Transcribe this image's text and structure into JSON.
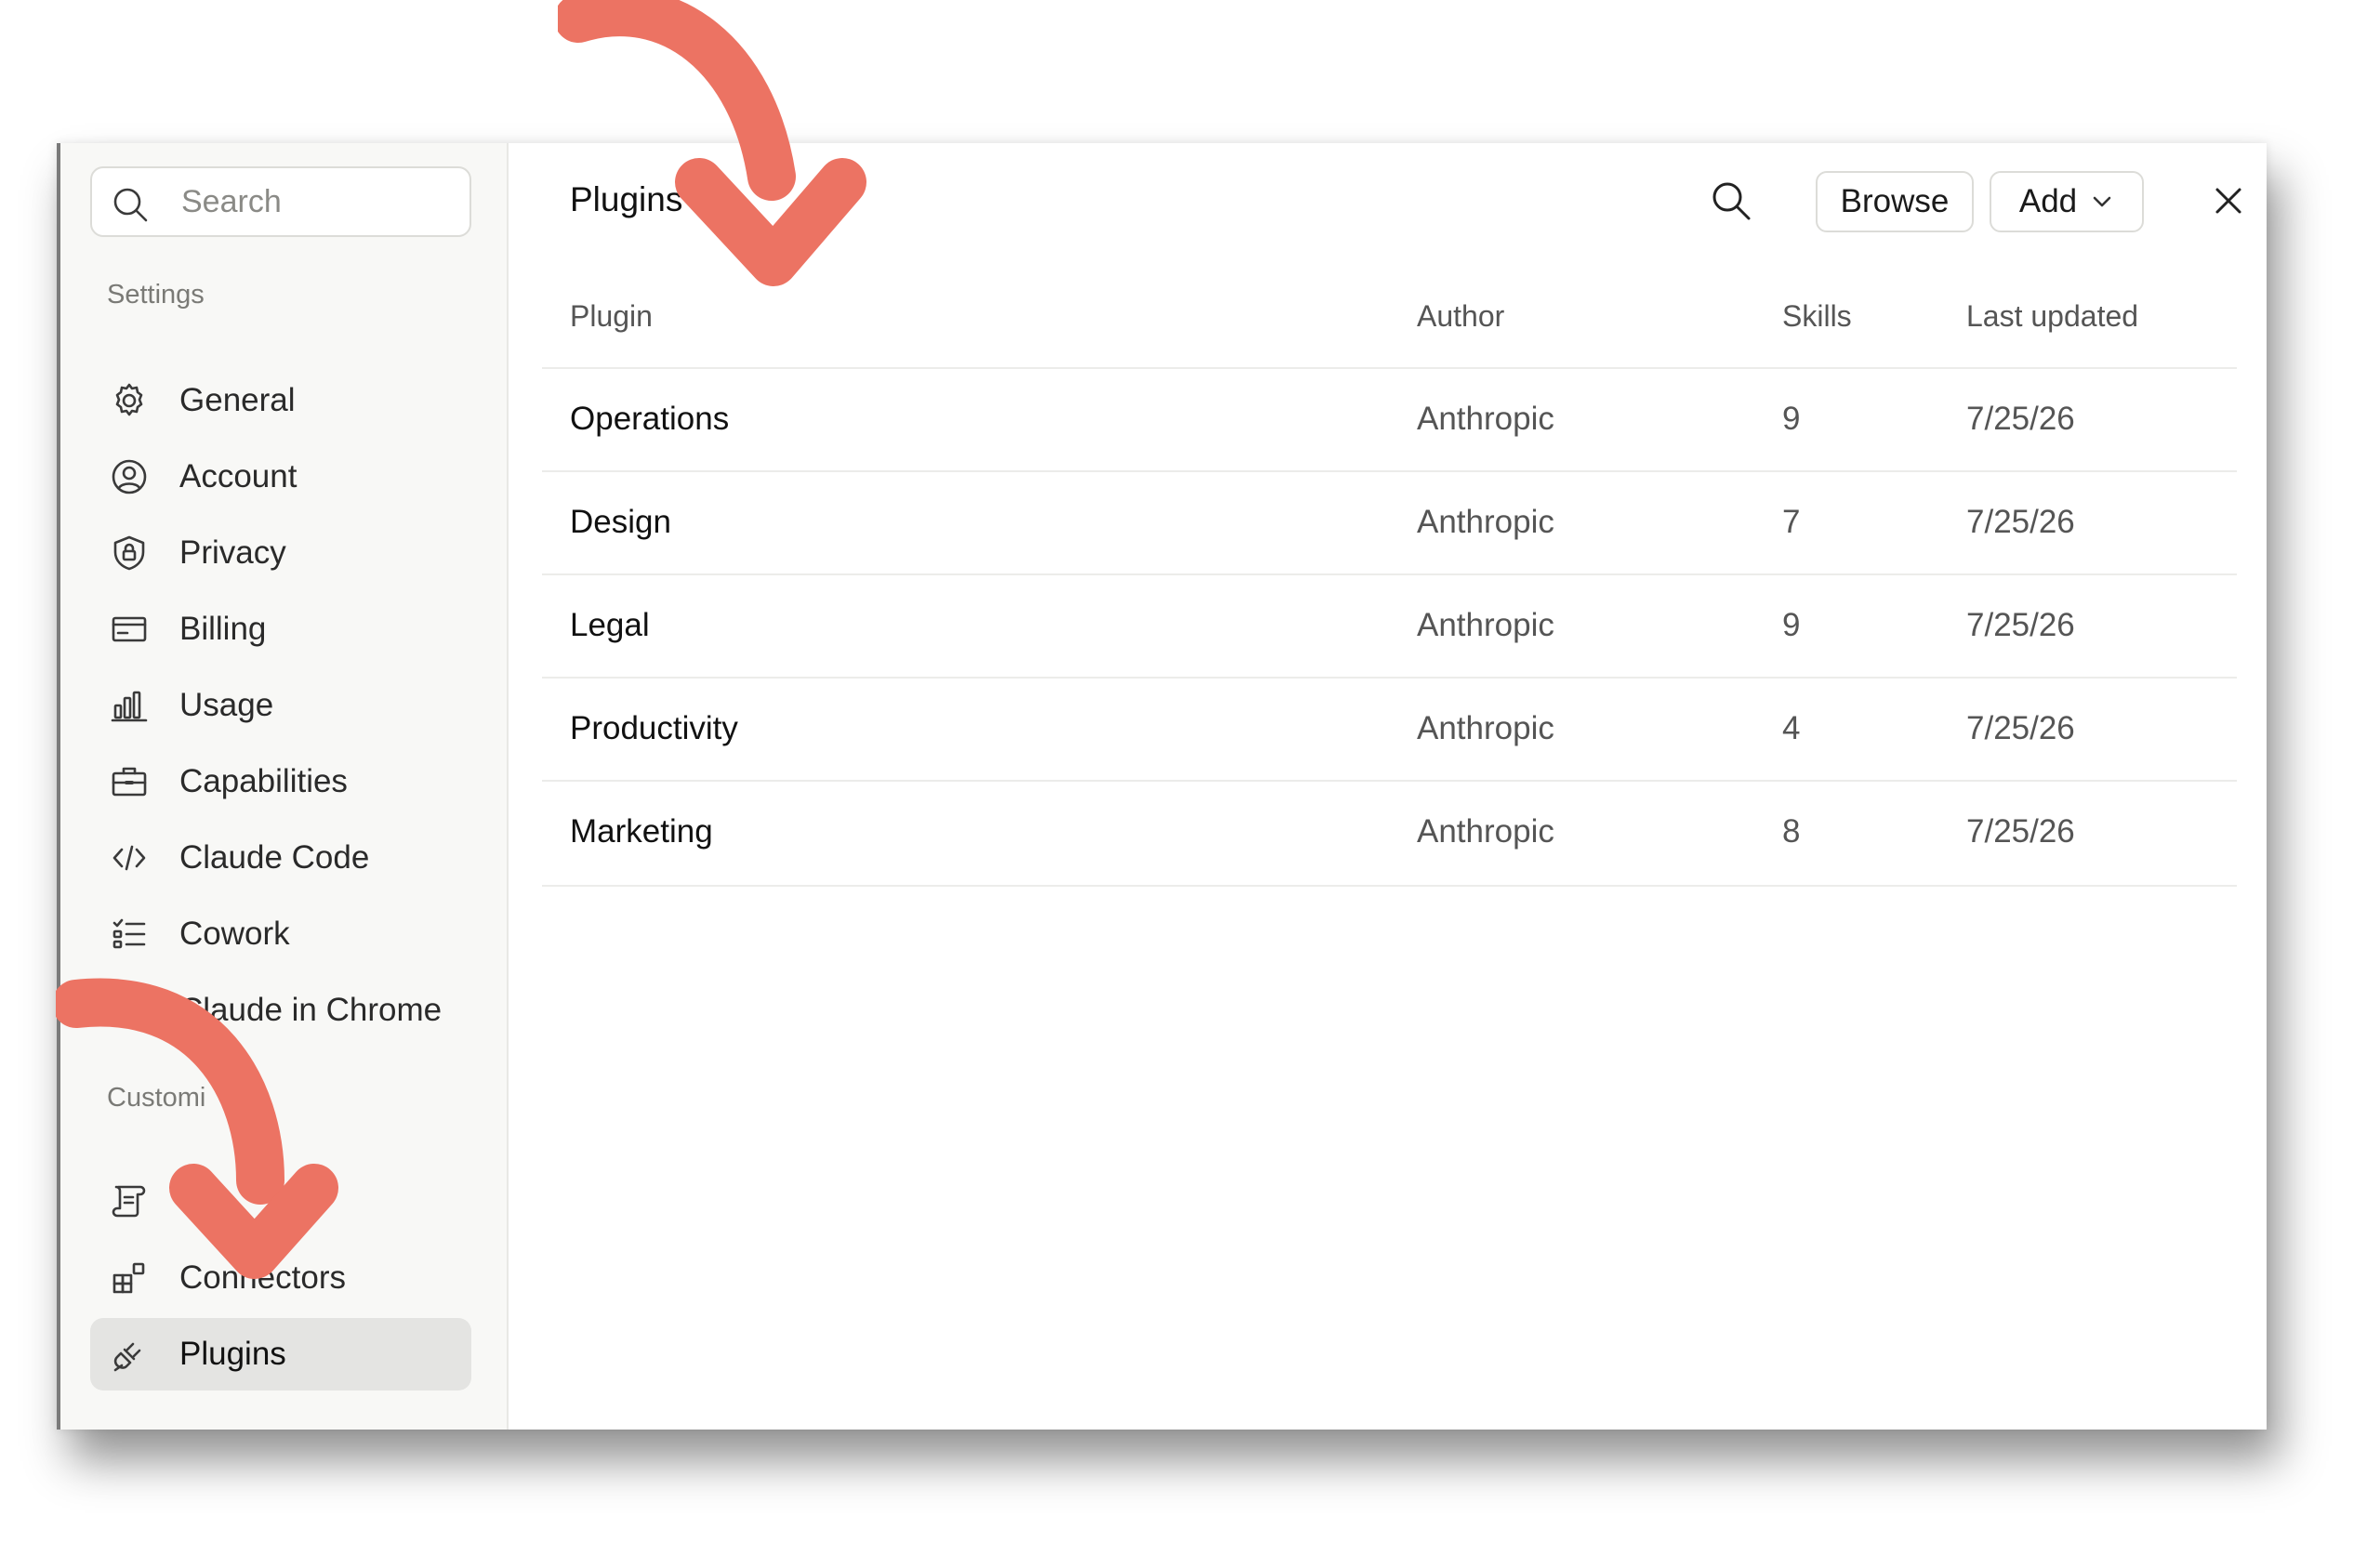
{
  "sidebar": {
    "search_placeholder": "Search",
    "settings_label": "Settings",
    "customize_label": "Customi",
    "items": [
      {
        "label": "General",
        "icon": "gear-icon"
      },
      {
        "label": "Account",
        "icon": "user-circle-icon"
      },
      {
        "label": "Privacy",
        "icon": "shield-lock-icon"
      },
      {
        "label": "Billing",
        "icon": "credit-card-icon"
      },
      {
        "label": "Usage",
        "icon": "bar-chart-icon"
      },
      {
        "label": "Capabilities",
        "icon": "briefcase-icon"
      },
      {
        "label": "Claude Code",
        "icon": "code-icon"
      },
      {
        "label": "Cowork",
        "icon": "checklist-icon"
      },
      {
        "label": "Claude in Chrome",
        "icon": "chrome-icon"
      }
    ],
    "customize_items": [
      {
        "label": "",
        "icon": "scroll-icon"
      },
      {
        "label": "Connectors",
        "icon": "grid-plus-icon"
      },
      {
        "label": "Plugins",
        "icon": "plug-icon",
        "active": true
      }
    ]
  },
  "header": {
    "title": "Plugins",
    "browse_label": "Browse",
    "add_label": "Add"
  },
  "table": {
    "columns": [
      "Plugin",
      "Author",
      "Skills",
      "Last updated"
    ],
    "rows": [
      {
        "plugin": "Operations",
        "author": "Anthropic",
        "skills": "9",
        "updated": "7/25/26"
      },
      {
        "plugin": "Design",
        "author": "Anthropic",
        "skills": "7",
        "updated": "7/25/26"
      },
      {
        "plugin": "Legal",
        "author": "Anthropic",
        "skills": "9",
        "updated": "7/25/26"
      },
      {
        "plugin": "Productivity",
        "author": "Anthropic",
        "skills": "4",
        "updated": "7/25/26"
      },
      {
        "plugin": "Marketing",
        "author": "Anthropic",
        "skills": "8",
        "updated": "7/25/26"
      }
    ]
  },
  "colors": {
    "annotation_arrow": "#ec7363",
    "active_item_bg": "#e4e4e2",
    "sidebar_bg": "#f8f8f6"
  }
}
